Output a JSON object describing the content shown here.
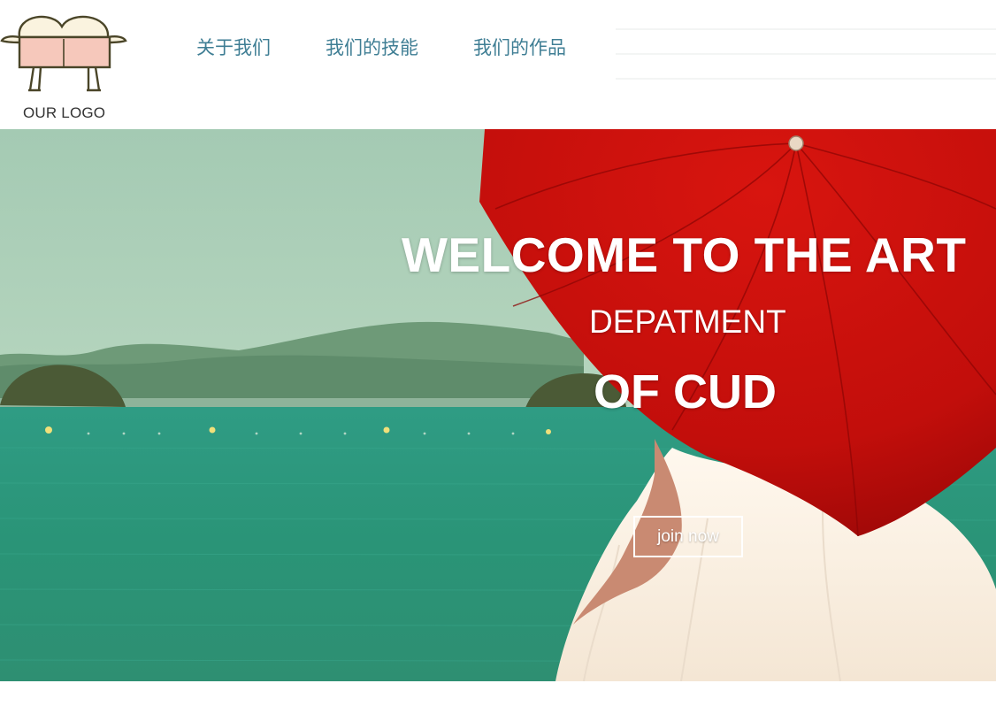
{
  "logo": {
    "text": "OUR LOGO",
    "icon": "cartoon-logo-icon"
  },
  "nav": {
    "items": [
      {
        "label": "关于我们"
      },
      {
        "label": "我们的技能"
      },
      {
        "label": "我们的作品"
      }
    ]
  },
  "hero": {
    "title": "WELCOME TO THE ART",
    "subtitle": "DEPATMENT",
    "subtitle2": "OF CUD",
    "button_label": "join now"
  },
  "colors": {
    "nav_text": "#3f7e94",
    "umbrella": "#c8100c",
    "sea": "#2e9a7e",
    "sky": "#a9cdb4"
  }
}
